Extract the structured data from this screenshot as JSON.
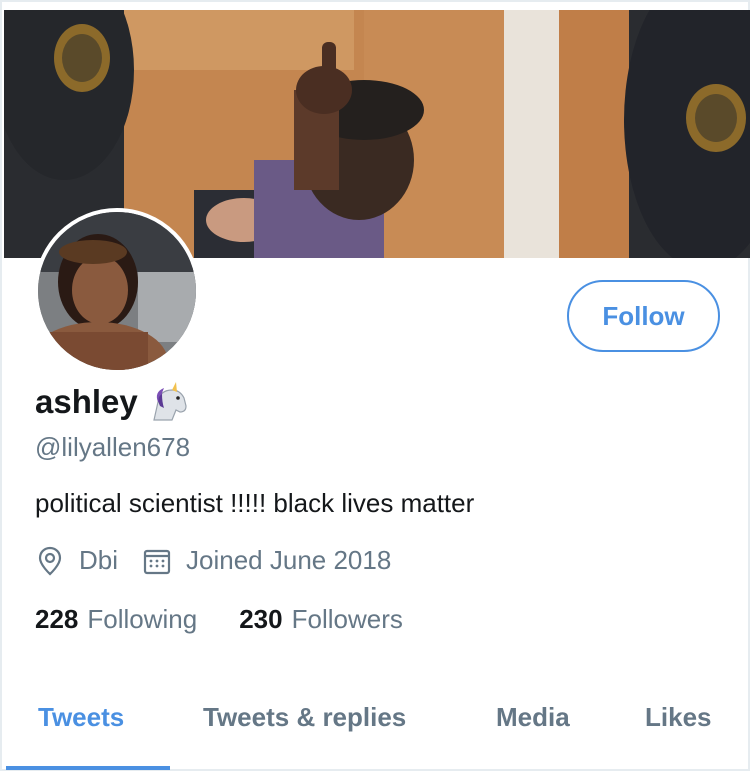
{
  "profile": {
    "display_name": "ashley",
    "handle": "@lilyallen678",
    "bio": "political scientist !!!!! black lives matter",
    "location": "Dbi",
    "joined": "Joined June 2018"
  },
  "actions": {
    "follow_label": "Follow"
  },
  "stats": {
    "following_count": "228",
    "following_label": "Following",
    "followers_count": "230",
    "followers_label": "Followers"
  },
  "tabs": [
    {
      "label": "Tweets",
      "active": true
    },
    {
      "label": "Tweets & replies",
      "active": false
    },
    {
      "label": "Media",
      "active": false
    },
    {
      "label": "Likes",
      "active": false
    }
  ],
  "icons": {
    "name_emoji": "unicorn-icon",
    "location": "location-pin-icon",
    "joined": "calendar-icon"
  },
  "colors": {
    "accent": "#4a90e2",
    "secondary_text": "#657786",
    "primary_text": "#14171a"
  }
}
